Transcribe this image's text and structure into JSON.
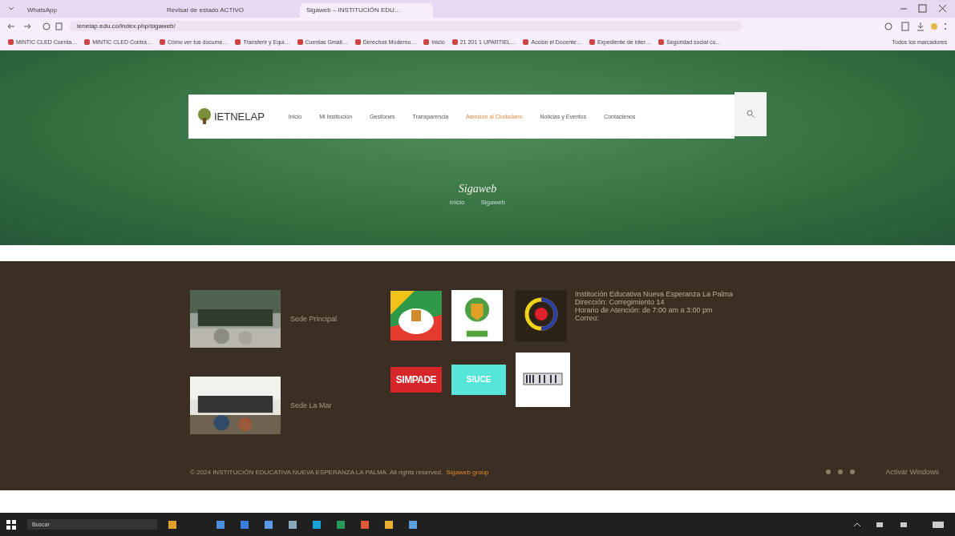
{
  "browser": {
    "tabs": [
      {
        "label": "WhatsApp",
        "selected": false
      },
      {
        "label": "Revisar de estado ACTIVO",
        "selected": false
      },
      {
        "label": "Sigaweb – INSTITUCIÓN EDU…",
        "selected": true
      }
    ],
    "url": "ienelap.edu.co/index.php/sigaweb/",
    "bookmarks": [
      "MINTIC CLED Cuenta…",
      "MINTIC CLED Contra…",
      "Cómo ver tus docume…",
      "Transferir y Equi…",
      "Cuentas Gmail…",
      "Derechos Moderno…",
      "Inicio",
      "21 201 1 UPARTIEL…",
      "Acción el Docente…",
      "Expediente de inter…",
      "Seguridad social cu…"
    ],
    "all_bookmarks": "Todos los marcadores"
  },
  "site": {
    "logo": "IETNELAP",
    "nav": [
      {
        "label": "Inicio",
        "selected": false
      },
      {
        "label": "Mi Institución",
        "selected": false
      },
      {
        "label": "Gestiones",
        "selected": false
      },
      {
        "label": "Transparencia",
        "selected": false
      },
      {
        "label": "Atención al Ciudadano",
        "selected": true
      },
      {
        "label": "Noticias y Eventos",
        "selected": false
      },
      {
        "label": "Contáctenos",
        "selected": false
      }
    ],
    "title": "Sigaweb",
    "breadcrumb": [
      "Inicio",
      "Sigaweb"
    ]
  },
  "footer": {
    "sedes": [
      "Sede Principal",
      "Sede La Mar"
    ],
    "logos": [
      {
        "kind": "flag"
      },
      {
        "kind": "crest"
      },
      {
        "kind": "circle"
      },
      {
        "kind": "text",
        "label": "SIMPADE"
      },
      {
        "kind": "teal",
        "label": "SIUCE"
      },
      {
        "kind": "barcode"
      }
    ],
    "contact": [
      "Institución Educativa Nueva Esperanza La Palma",
      "Dirección: Corregimiento 14",
      "Horario de Atención: de 7:00 am a 3:00 pm",
      "Correo:"
    ],
    "copyright": "© 2024 INSTITUCIÓN EDUCATIVA NUEVA ESPERANZA LA PALMA. All rights reserved.",
    "credit": "Sigaweb group"
  },
  "activation": "Activar Windows",
  "taskbar": {
    "search": "Buscar"
  }
}
